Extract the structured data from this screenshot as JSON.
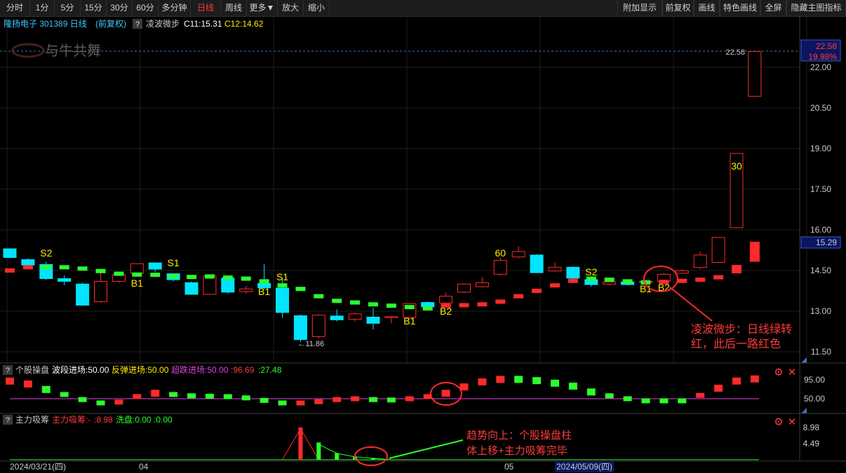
{
  "toolbar": {
    "left": [
      "分时",
      "1分",
      "5分",
      "15分",
      "30分",
      "60分",
      "多分钟",
      "日线",
      "周线",
      "更多▼",
      "放大",
      "缩小"
    ],
    "active_index": 7,
    "right": [
      "附加显示",
      "前复权",
      "画线",
      "特色画线",
      "全屏",
      "隐藏主图指标"
    ]
  },
  "header": {
    "stock": "隆扬电子 301389 日线",
    "adjust": "(前复权)",
    "help": "?",
    "indicator": "凌波微步",
    "c1": "C11:15.31",
    "c2": "C12:14.62"
  },
  "watermark": "与牛共舞",
  "price_axis": {
    "ticks": [
      "22.00",
      "20.50",
      "19.00",
      "17.50",
      "16.00",
      "14.50",
      "13.00",
      "11.50"
    ],
    "limit_price": "22.58",
    "limit_pct": "19.98%",
    "last_price": "15.29",
    "inline_limit": "22.58",
    "low_label": "11.86"
  },
  "signals": [
    {
      "text": "S2",
      "color": "#ffee00"
    },
    {
      "text": "B1",
      "color": "#ffee00"
    },
    {
      "text": "S1",
      "color": "#ffee00"
    },
    {
      "text": "S1",
      "color": "#ffee00"
    },
    {
      "text": "B1",
      "color": "#ffee00"
    },
    {
      "text": "B1",
      "color": "#ffee00"
    },
    {
      "text": "B2",
      "color": "#ffee00"
    },
    {
      "text": "60",
      "color": "#ffee00"
    },
    {
      "text": "S2",
      "color": "#ffee00"
    },
    {
      "text": "B1",
      "color": "#ffee00"
    },
    {
      "text": "B2",
      "color": "#ffee00"
    },
    {
      "text": "30",
      "color": "#ffee00"
    }
  ],
  "annotations": {
    "a1_line1": "凌波微步：日线绿转",
    "a1_line2": "红，此后一路红色",
    "a2_line1": "趋势向上：个股操盘柱",
    "a2_line2": "体上移+主力吸筹完毕"
  },
  "panel2": {
    "help": "?",
    "name": "个股操盘",
    "f1": "波段进场:50.00",
    "f2": "反弹进场:50.00",
    "f3": "超跌进场:50.00",
    "f4": ":96.69",
    "f5": ":27.48",
    "axis": [
      "95.00",
      "50.00"
    ]
  },
  "panel3": {
    "help": "?",
    "name": "主力吸筹",
    "f1": "主力吸筹:-",
    "f1b": ":8.98",
    "f2": "洗盘:0.00",
    "f3": ":0.00",
    "axis": [
      "8.98",
      "4.49"
    ]
  },
  "dates": {
    "d1": "2024/03/21(四)",
    "d2": "04",
    "d3": "05",
    "d4": "2024/05/09(四)"
  },
  "colors": {
    "up": "#ff2a2a",
    "down": "#00e5ff",
    "green": "#2bff2b",
    "magenta": "#e040e0",
    "yellow": "#ffee00",
    "grid": "#1e1e1e"
  },
  "chart_data": {
    "type": "candlestick",
    "candles": [
      {
        "o": 15.3,
        "c": 14.98,
        "h": 15.32,
        "l": 14.95
      },
      {
        "o": 14.9,
        "c": 14.7,
        "h": 14.95,
        "l": 14.58
      },
      {
        "o": 14.72,
        "c": 14.2,
        "h": 14.82,
        "l": 14.15
      },
      {
        "o": 14.2,
        "c": 14.1,
        "h": 14.32,
        "l": 13.95
      },
      {
        "o": 14.0,
        "c": 13.22,
        "h": 14.05,
        "l": 13.2
      },
      {
        "o": 13.35,
        "c": 14.1,
        "h": 14.45,
        "l": 13.3
      },
      {
        "o": 14.1,
        "c": 14.35,
        "h": 14.42,
        "l": 14.05
      },
      {
        "o": 14.4,
        "c": 14.75,
        "h": 14.76,
        "l": 14.35
      },
      {
        "o": 14.78,
        "c": 14.55,
        "h": 14.8,
        "l": 14.45
      },
      {
        "o": 14.38,
        "c": 14.16,
        "h": 14.4,
        "l": 14.1
      },
      {
        "o": 14.05,
        "c": 13.62,
        "h": 14.1,
        "l": 13.6
      },
      {
        "o": 13.62,
        "c": 14.3,
        "h": 14.32,
        "l": 13.6
      },
      {
        "o": 14.22,
        "c": 13.7,
        "h": 14.25,
        "l": 13.65
      },
      {
        "o": 13.72,
        "c": 13.82,
        "h": 13.93,
        "l": 13.65
      },
      {
        "o": 14.02,
        "c": 13.86,
        "h": 14.73,
        "l": 13.8
      },
      {
        "o": 13.85,
        "c": 12.95,
        "h": 14.2,
        "l": 12.75
      },
      {
        "o": 12.83,
        "c": 11.95,
        "h": 12.88,
        "l": 11.86
      },
      {
        "o": 12.06,
        "c": 12.85,
        "h": 12.88,
        "l": 12.0
      },
      {
        "o": 12.82,
        "c": 12.68,
        "h": 13.06,
        "l": 12.62
      },
      {
        "o": 12.7,
        "c": 12.9,
        "h": 12.95,
        "l": 12.62
      },
      {
        "o": 12.78,
        "c": 12.55,
        "h": 13.12,
        "l": 12.32
      },
      {
        "o": 12.76,
        "c": 12.8,
        "h": 12.82,
        "l": 12.55
      },
      {
        "o": 12.76,
        "c": 13.28,
        "h": 13.3,
        "l": 12.7
      },
      {
        "o": 13.32,
        "c": 13.16,
        "h": 13.35,
        "l": 13.05
      },
      {
        "o": 13.3,
        "c": 13.55,
        "h": 13.68,
        "l": 13.25
      },
      {
        "o": 13.7,
        "c": 14.0,
        "h": 14.02,
        "l": 13.65
      },
      {
        "o": 13.9,
        "c": 14.05,
        "h": 14.26,
        "l": 13.88
      },
      {
        "o": 14.36,
        "c": 14.87,
        "h": 15.0,
        "l": 14.3
      },
      {
        "o": 15.0,
        "c": 15.2,
        "h": 15.4,
        "l": 14.95
      },
      {
        "o": 15.07,
        "c": 14.42,
        "h": 15.1,
        "l": 14.4
      },
      {
        "o": 14.48,
        "c": 14.62,
        "h": 14.8,
        "l": 14.46
      },
      {
        "o": 14.62,
        "c": 14.22,
        "h": 14.65,
        "l": 14.15
      },
      {
        "o": 14.16,
        "c": 13.98,
        "h": 14.22,
        "l": 13.9
      },
      {
        "o": 14.0,
        "c": 14.08,
        "h": 14.19,
        "l": 13.95
      },
      {
        "o": 14.08,
        "c": 13.98,
        "h": 14.13,
        "l": 13.95
      },
      {
        "o": 14.06,
        "c": 14.1,
        "h": 14.16,
        "l": 14.04
      },
      {
        "o": 14.1,
        "c": 14.36,
        "h": 14.4,
        "l": 14.08
      },
      {
        "o": 14.4,
        "c": 14.49,
        "h": 14.55,
        "l": 14.38
      },
      {
        "o": 14.61,
        "c": 15.07,
        "h": 15.2,
        "l": 14.55
      },
      {
        "o": 14.8,
        "c": 15.72,
        "h": 15.72,
        "l": 14.78
      },
      {
        "o": 16.08,
        "c": 18.82,
        "h": 18.82,
        "l": 16.08
      },
      {
        "o": 20.93,
        "c": 22.58,
        "h": 22.58,
        "l": 20.93
      }
    ],
    "linbo": [
      {
        "v": 14.5,
        "c": "red"
      },
      {
        "v": 14.62,
        "c": "red"
      },
      {
        "v": 14.62,
        "c": "green"
      },
      {
        "v": 14.62,
        "c": "green"
      },
      {
        "v": 14.57,
        "c": "green"
      },
      {
        "v": 14.48,
        "c": "green"
      },
      {
        "v": 14.38,
        "c": "green"
      },
      {
        "v": 14.35,
        "c": "green"
      },
      {
        "v": 14.34,
        "c": "green"
      },
      {
        "v": 14.28,
        "c": "green"
      },
      {
        "v": 14.26,
        "c": "green"
      },
      {
        "v": 14.28,
        "c": "green"
      },
      {
        "v": 14.24,
        "c": "green"
      },
      {
        "v": 14.2,
        "c": "green"
      },
      {
        "v": 14.1,
        "c": "green"
      },
      {
        "v": 13.95,
        "c": "green"
      },
      {
        "v": 13.82,
        "c": "green"
      },
      {
        "v": 13.55,
        "c": "green"
      },
      {
        "v": 13.38,
        "c": "green"
      },
      {
        "v": 13.32,
        "c": "green"
      },
      {
        "v": 13.25,
        "c": "green"
      },
      {
        "v": 13.2,
        "c": "green"
      },
      {
        "v": 13.15,
        "c": "green"
      },
      {
        "v": 13.1,
        "c": "green"
      },
      {
        "v": 13.2,
        "c": "red"
      },
      {
        "v": 13.22,
        "c": "red"
      },
      {
        "v": 13.25,
        "c": "red"
      },
      {
        "v": 13.35,
        "c": "red"
      },
      {
        "v": 13.55,
        "c": "red"
      },
      {
        "v": 13.75,
        "c": "red"
      },
      {
        "v": 13.95,
        "c": "red"
      },
      {
        "v": 14.12,
        "c": "red"
      },
      {
        "v": 14.2,
        "c": "green"
      },
      {
        "v": 14.16,
        "c": "green"
      },
      {
        "v": 14.1,
        "c": "green"
      },
      {
        "v": 14.06,
        "c": "green"
      },
      {
        "v": 14.08,
        "c": "red"
      },
      {
        "v": 14.12,
        "c": "red"
      },
      {
        "v": 14.16,
        "c": "red"
      },
      {
        "v": 14.25,
        "c": "red"
      },
      {
        "v": 14.5,
        "c": "red"
      },
      {
        "v": 14.9,
        "c": "red"
      }
    ],
    "signal_positions": [
      2,
      7,
      9,
      15,
      14,
      22,
      24,
      27,
      32,
      35,
      36,
      40
    ],
    "panel2_bars": [
      {
        "v": 92,
        "c": "red"
      },
      {
        "v": 85,
        "c": "red"
      },
      {
        "v": 72,
        "c": "green"
      },
      {
        "v": 60,
        "c": "green"
      },
      {
        "v": 48,
        "c": "green"
      },
      {
        "v": 40,
        "c": "green"
      },
      {
        "v": 42,
        "c": "red"
      },
      {
        "v": 55,
        "c": "red"
      },
      {
        "v": 63,
        "c": "red"
      },
      {
        "v": 60,
        "c": "green"
      },
      {
        "v": 57,
        "c": "green"
      },
      {
        "v": 56,
        "c": "green"
      },
      {
        "v": 55,
        "c": "green"
      },
      {
        "v": 52,
        "c": "green"
      },
      {
        "v": 46,
        "c": "green"
      },
      {
        "v": 40,
        "c": "green"
      },
      {
        "v": 40,
        "c": "red"
      },
      {
        "v": 43,
        "c": "red"
      },
      {
        "v": 48,
        "c": "red"
      },
      {
        "v": 50,
        "c": "red"
      },
      {
        "v": 48,
        "c": "green"
      },
      {
        "v": 47,
        "c": "green"
      },
      {
        "v": 50,
        "c": "red"
      },
      {
        "v": 55,
        "c": "red"
      },
      {
        "v": 63,
        "c": "red"
      },
      {
        "v": 78,
        "c": "red"
      },
      {
        "v": 90,
        "c": "red"
      },
      {
        "v": 96,
        "c": "red"
      },
      {
        "v": 96,
        "c": "green"
      },
      {
        "v": 93,
        "c": "green"
      },
      {
        "v": 87,
        "c": "green"
      },
      {
        "v": 80,
        "c": "green"
      },
      {
        "v": 66,
        "c": "green"
      },
      {
        "v": 57,
        "c": "green"
      },
      {
        "v": 50,
        "c": "green"
      },
      {
        "v": 45,
        "c": "green"
      },
      {
        "v": 45,
        "c": "green"
      },
      {
        "v": 45,
        "c": "green"
      },
      {
        "v": 58,
        "c": "red"
      },
      {
        "v": 75,
        "c": "red"
      },
      {
        "v": 92,
        "c": "red"
      },
      {
        "v": 97,
        "c": "red"
      }
    ],
    "panel3_bars": [
      {
        "i": 16,
        "v": 8.98,
        "c": "red"
      },
      {
        "i": 17,
        "v": 4.8,
        "c": "green"
      },
      {
        "i": 18,
        "v": 1.8,
        "c": "green"
      },
      {
        "i": 19,
        "v": 0.9,
        "c": "green"
      },
      {
        "i": 20,
        "v": 0.5,
        "c": "green"
      }
    ]
  }
}
